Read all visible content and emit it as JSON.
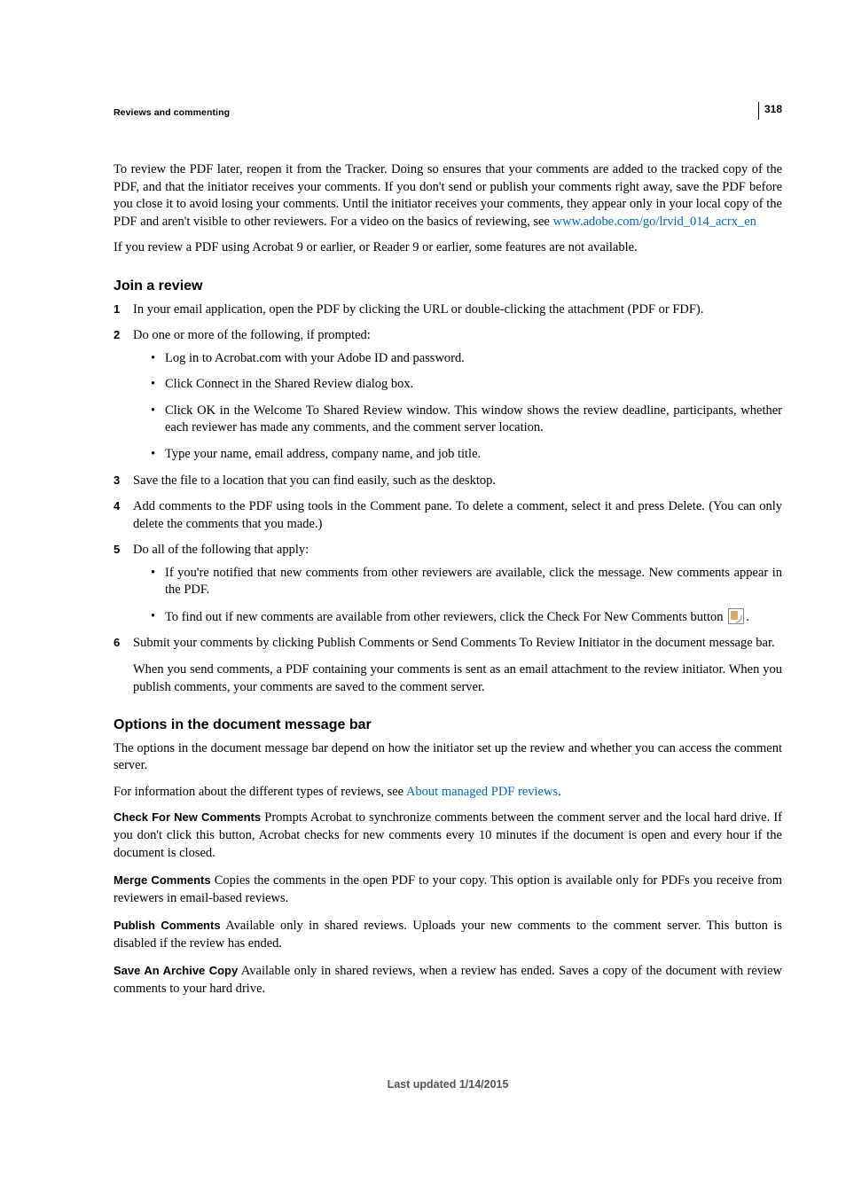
{
  "page_number": "318",
  "running_head": "Reviews and commenting",
  "intro": {
    "p1a": "To review the PDF later, reopen it from the Tracker. Doing so ensures that your comments are added to the tracked copy of the PDF, and that the initiator receives your comments. If you don't send or publish your comments right away, save the PDF before you close it to avoid losing your comments. Until the initiator receives your comments, they appear only in your local copy of the PDF and aren't visible to other reviewers. For a video on the basics of reviewing, see ",
    "p1_link": "www.adobe.com/go/lrvid_014_acrx_en",
    "p2": "If you review a PDF using Acrobat 9 or earlier, or Reader 9 or earlier, some features are not available."
  },
  "section1": {
    "heading": "Join a review",
    "step1": "In your email application, open the PDF by clicking the URL or double-clicking the attachment (PDF or FDF).",
    "step2_intro": "Do one or more of the following, if prompted:",
    "step2_b1": "Log in to Acrobat.com with your Adobe ID and password.",
    "step2_b2": "Click Connect in the Shared Review dialog box.",
    "step2_b3": "Click OK in the Welcome To Shared Review window. This window shows the review deadline, participants, whether each reviewer has made any comments, and the comment server location.",
    "step2_b4": "Type your name, email address, company name, and job title.",
    "step3": "Save the file to a location that you can find easily, such as the desktop.",
    "step4": "Add comments to the PDF using tools in the Comment pane. To delete a comment, select it and press Delete. (You can only delete the comments that you made.)",
    "step5_intro": "Do all of the following that apply:",
    "step5_b1": "If you're notified that new comments from other reviewers are available, click the message. New comments appear in the PDF.",
    "step5_b2": "To find out if new comments are available from other reviewers, click the Check For New Comments button ",
    "step5_b2_end": ".",
    "step6": "Submit your comments by clicking Publish Comments or Send Comments To Review Initiator in the document message bar.",
    "step6_body": "When you send comments, a PDF containing your comments is sent as an email attachment to the review initiator. When you publish comments, your comments are saved to the comment server."
  },
  "section2": {
    "heading": "Options in the document message bar",
    "p1": "The options in the document message bar depend on how the initiator set up the review and whether you can access the comment server.",
    "p2a": "For information about the different types of reviews, see ",
    "p2_link": "About managed PDF reviews",
    "p2b": ".",
    "t1": "Check For New Comments",
    "d1": " Prompts Acrobat to synchronize comments between the comment server and the local hard drive. If you don't click this button, Acrobat checks for new comments every 10 minutes if the document is open and every hour if the document is closed.",
    "t2": "Merge Comments",
    "d2": " Copies the comments in the open PDF to your copy. This option is available only for PDFs you receive from reviewers in email-based reviews.",
    "t3": "Publish Comments",
    "d3": " Available only in shared reviews. Uploads your new comments to the comment server. This button is disabled if the review has ended.",
    "t4": "Save An Archive Copy",
    "d4": " Available only in shared reviews, when a review has ended. Saves a copy of the document with review comments to your hard drive."
  },
  "footer": "Last updated 1/14/2015"
}
